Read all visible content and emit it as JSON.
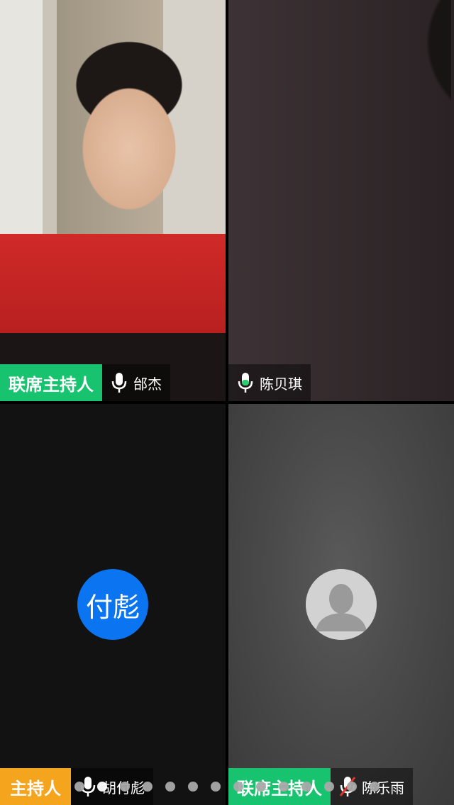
{
  "participants": [
    {
      "role": "联席主持人",
      "name": "邰杰",
      "mic": "on"
    },
    {
      "role": "",
      "name": "陈贝琪",
      "mic": "on"
    },
    {
      "role": "主持人",
      "name": "胡付彪",
      "mic": "on",
      "avatar_text": "付彪"
    },
    {
      "role": "联席主持人",
      "name": "陈乐雨",
      "mic": "muted"
    }
  ],
  "pager": {
    "total": 14,
    "current": 2
  },
  "colors": {
    "co_host_badge": "#18c36f",
    "host_badge": "#f5a51d",
    "avatar_blue": "#0b74f0",
    "mic_active": "#2ecc71",
    "mic_muted": "#e0342f"
  },
  "icons": {
    "mic": "microphone-icon",
    "mic_muted": "microphone-muted-icon",
    "default_avatar": "person-silhouette-icon"
  }
}
